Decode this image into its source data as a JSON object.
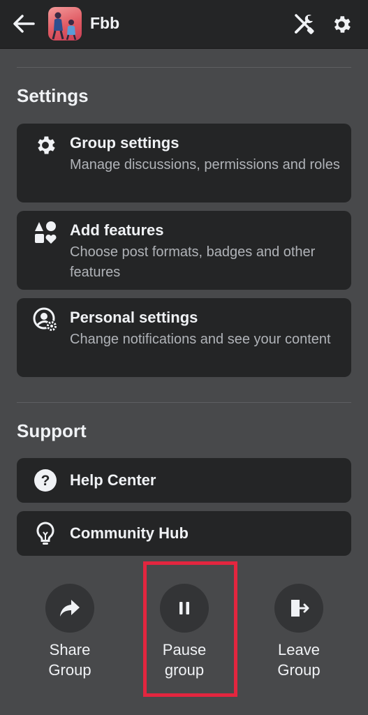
{
  "header": {
    "group_name": "Fbb",
    "back_icon": "arrow-left-icon",
    "tools_icon": "wrench-screwdriver-icon",
    "settings_icon": "gear-icon"
  },
  "settings": {
    "title": "Settings",
    "items": [
      {
        "icon": "gear-icon",
        "title": "Group settings",
        "desc": "Manage discussions, permissions and roles"
      },
      {
        "icon": "shapes-icon",
        "title": "Add features",
        "desc": "Choose post formats, badges and other features"
      },
      {
        "icon": "person-gear-icon",
        "title": "Personal settings",
        "desc": "Change notifications and see your content"
      }
    ]
  },
  "support": {
    "title": "Support",
    "items": [
      {
        "icon": "question-circle-icon",
        "title": "Help Center"
      },
      {
        "icon": "lightbulb-icon",
        "title": "Community Hub"
      }
    ]
  },
  "actions": [
    {
      "icon": "share-arrow-icon",
      "label_line1": "Share",
      "label_line2": "Group"
    },
    {
      "icon": "pause-icon",
      "label_line1": "Pause",
      "label_line2": "group"
    },
    {
      "icon": "leave-door-icon",
      "label_line1": "Leave",
      "label_line2": "Group"
    }
  ],
  "colors": {
    "background": "#48494b",
    "card": "#242526",
    "highlight": "#e3263f"
  }
}
